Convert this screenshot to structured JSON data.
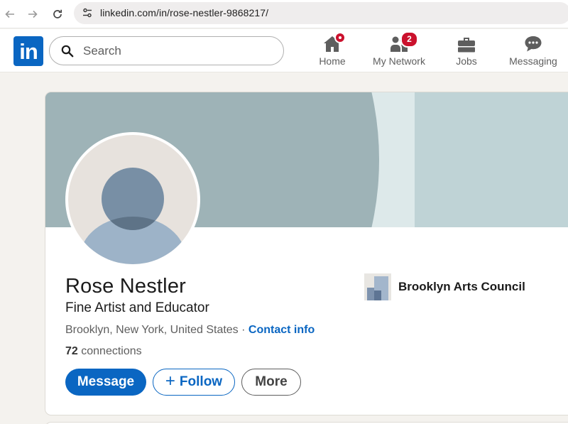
{
  "browser": {
    "url": "linkedin.com/in/rose-nestler-9868217/",
    "icons": [
      "back-arrow-icon",
      "forward-arrow-icon",
      "reload-icon",
      "site-settings-icon"
    ]
  },
  "header": {
    "logo_text": "in",
    "search": {
      "placeholder": "Search",
      "value": ""
    },
    "nav": [
      {
        "label": "Home",
        "icon": "home-icon",
        "badge": "dot"
      },
      {
        "label": "My Network",
        "icon": "people-icon",
        "badge": "2"
      },
      {
        "label": "Jobs",
        "icon": "briefcase-icon",
        "badge": ""
      },
      {
        "label": "Messaging",
        "icon": "chat-icon",
        "badge": ""
      }
    ]
  },
  "profile": {
    "name": "Rose Nestler",
    "headline": "Fine Artist and Educator",
    "location": "Brooklyn, New York, United States",
    "separator": " · ",
    "contact_label": "Contact info",
    "connections_count": "72",
    "connections_label": " connections",
    "organization": "Brooklyn Arts Council",
    "buttons": {
      "message": "Message",
      "follow": "Follow",
      "follow_icon": "+",
      "more": "More"
    }
  },
  "colors": {
    "brand": "#0a66c2",
    "badge": "#cb112d",
    "cover": "#9eb3b7"
  }
}
